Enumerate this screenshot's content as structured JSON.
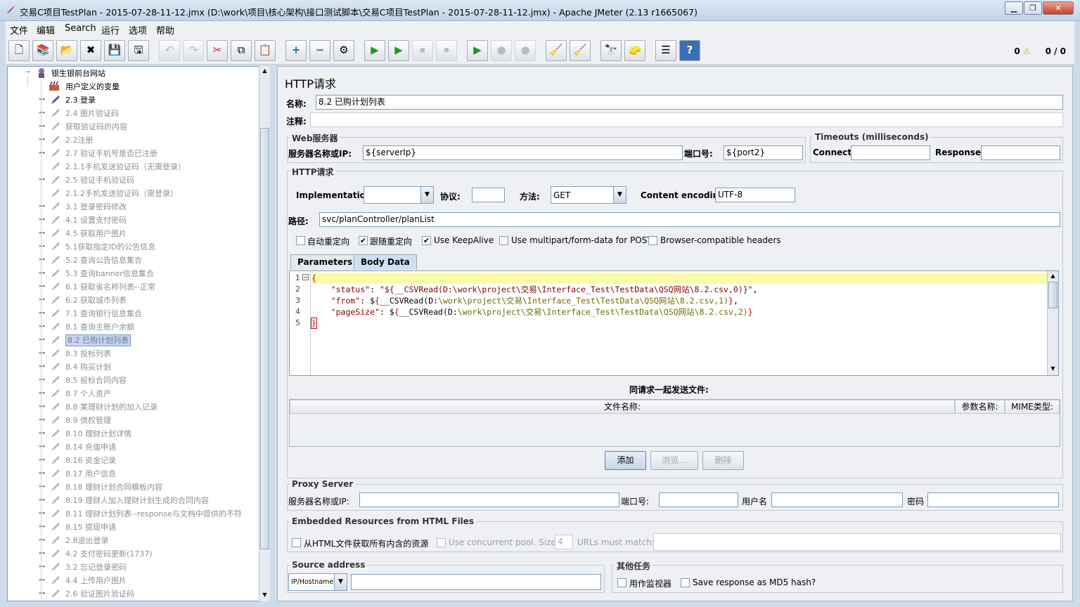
{
  "window": {
    "title": "交易C项目TestPlan - 2015-07-28-11-12.jmx (D:\\work\\项目\\核心架构\\接口测试脚本\\交易C项目TestPlan - 2015-07-28-11-12.jmx) - Apache JMeter (2.13 r1665067)",
    "min": "▁",
    "max": "❐",
    "close": "✕"
  },
  "menu": [
    "文件",
    "编辑",
    "Search",
    "运行",
    "选项",
    "帮助"
  ],
  "toolbar": {
    "icons": [
      {
        "name": "new-icon",
        "glyph": "🗋",
        "dis": false
      },
      {
        "name": "templates-icon",
        "glyph": "📚",
        "dis": false
      },
      {
        "name": "open-icon",
        "glyph": "📂",
        "dis": false
      },
      {
        "name": "close-file-icon",
        "glyph": "✖",
        "dis": false
      },
      {
        "name": "save-icon",
        "glyph": "💾",
        "dis": false
      },
      {
        "name": "save-as-icon",
        "glyph": "🖫",
        "dis": false
      },
      {
        "name": "undo-icon",
        "glyph": "↶",
        "dis": true
      },
      {
        "name": "redo-icon",
        "glyph": "↷",
        "dis": true
      },
      {
        "name": "cut-icon",
        "glyph": "✂",
        "dis": false
      },
      {
        "name": "copy-icon",
        "glyph": "⧉",
        "dis": false
      },
      {
        "name": "paste-icon",
        "glyph": "📋",
        "dis": false
      },
      {
        "name": "expand-icon",
        "glyph": "+",
        "dis": false
      },
      {
        "name": "collapse-icon",
        "glyph": "−",
        "dis": false
      },
      {
        "name": "toggle-icon",
        "glyph": "⚙",
        "dis": false
      },
      {
        "name": "start-icon",
        "glyph": "▶",
        "dis": false
      },
      {
        "name": "start-no-pause-icon",
        "glyph": "▶",
        "dis": false
      },
      {
        "name": "stop-icon",
        "glyph": "⏹",
        "dis": true
      },
      {
        "name": "shutdown-icon",
        "glyph": "⏺",
        "dis": true
      },
      {
        "name": "remote-start-icon",
        "glyph": "▶",
        "dis": false
      },
      {
        "name": "remote-stop-icon",
        "glyph": "●",
        "dis": true
      },
      {
        "name": "remote-shutdown-icon",
        "glyph": "●",
        "dis": true
      },
      {
        "name": "clear-icon",
        "glyph": "🧹",
        "dis": false
      },
      {
        "name": "clear-all-icon",
        "glyph": "🧹",
        "dis": false
      },
      {
        "name": "search-icon",
        "glyph": "🔭",
        "dis": false
      },
      {
        "name": "reset-search-icon",
        "glyph": "🧽",
        "dis": false
      },
      {
        "name": "function-helper-icon",
        "glyph": "☰",
        "dis": false
      },
      {
        "name": "help-icon",
        "glyph": "?",
        "dis": false
      }
    ],
    "error_count": "0",
    "warn_icon": "⚠",
    "threads": "0 / 0"
  },
  "tree": {
    "root": "银生银前台网站",
    "vars": "用户定义的变量",
    "items": [
      "2.3 登录",
      "2.4 图片验证码",
      "获取验证码的内容",
      "2.2注册",
      "2.7 验证手机号是否已注册",
      "2.1.1手机发送验证码（无需登录）",
      "2.5 验证手机验证码",
      "2.1.2手机发送验证码（需登录）",
      "3.1 登录密码修改",
      "4.1 设置支付密码",
      "4.5 获取用户图片",
      "5.1获取指定ID的公告信息",
      "5.2 查询公告信息集合",
      "5.3 查询banner信息集合",
      "6.1 获取省名称列表--正常",
      "6.2 获取城市列表",
      "7.1 查询银行信息集合",
      "8.1 查询主账户余额",
      "8.2 已购计划列表",
      "8.3 投标列表",
      "8.4 购买计划",
      "8.5 投标合同内容",
      "8.7 个人资产",
      "8.8 某理财计划的加入记录",
      "8.9 债权管理",
      "8.10 理财计划详情",
      "8.14 充值申请",
      "8.16 资金记录",
      "8.17 用户信息",
      "8.18 理财计划合同模板内容",
      "8.19 理财人加入理财计划生成的合同内容",
      "8.11 理财计划列表--response与文档中提供的不符",
      "8.15 提现申请",
      "2.8退出登录",
      "4.2 支付密码更新(1737)",
      "3.2 忘记登录密码",
      "4.4 上传用户图片",
      "2.6 验证图片验证码"
    ],
    "selected_index": 18,
    "active_index": 0
  },
  "main": {
    "heading": "HTTP请求",
    "name_label": "名称:",
    "name_value": "8.2 已购计划列表",
    "comment_label": "注释:",
    "comment_value": "",
    "web_server_legend": "Web服务器",
    "server_label": "服务器名称或IP:",
    "server_value": "${serverIp}",
    "port_label": "端口号:",
    "port_value": "${port2}",
    "timeouts_legend": "Timeouts (milliseconds)",
    "connect_label": "Connect:",
    "connect_value": "",
    "response_label": "Response:",
    "response_value": "",
    "http_legend": "HTTP请求",
    "impl_label": "Implementation:",
    "impl_value": "",
    "protocol_label": "协议:",
    "protocol_value": "",
    "method_label": "方法:",
    "method_value": "GET",
    "encoding_label": "Content encoding:",
    "encoding_value": "UTF-8",
    "path_label": "路径:",
    "path_value": "svc/planController/planList",
    "checkboxes": [
      {
        "label": "自动重定向",
        "checked": false
      },
      {
        "label": "跟随重定向",
        "checked": true
      },
      {
        "label": "Use KeepAlive",
        "checked": true
      },
      {
        "label": "Use multipart/form-data for POST",
        "checked": false
      },
      {
        "label": "Browser-compatible headers",
        "checked": false
      }
    ],
    "tabs": [
      "Parameters",
      "Body Data"
    ],
    "body_lines": [
      "1",
      "2",
      "3",
      "4",
      "5"
    ],
    "files_title": "同请求一起发送文件:",
    "files_cols": [
      "文件名称:",
      "参数名称:",
      "MIME类型:"
    ],
    "btn_add": "添加",
    "btn_browse": "浏览...",
    "btn_delete": "删除",
    "proxy_legend": "Proxy Server",
    "proxy_server_label": "服务器名称或IP:",
    "proxy_server_value": "",
    "proxy_port_label": "端口号:",
    "proxy_port_value": "",
    "proxy_user_label": "用户名",
    "proxy_user_value": "",
    "proxy_pass_label": "密码",
    "proxy_pass_value": "",
    "embedded_legend": "Embedded Resources from HTML Files",
    "embedded_chk": "从HTML文件获取所有内含的资源",
    "concurrent_chk": "Use concurrent pool. Size:",
    "pool_size": "4",
    "urls_label": "URLs must match:",
    "urls_value": "",
    "source_legend": "Source address",
    "source_type": "IP/Hostname",
    "source_value": "",
    "other_legend": "其他任务",
    "monitor_chk": "用作监视器",
    "md5_chk": "Save response as MD5 hash?"
  },
  "code": {
    "l1": "{",
    "l2a": "    \"status\"",
    "l2b": ": ",
    "l2c": "\"${__CSVRead(D:\\work\\project\\交易\\Interface_Test\\TestData\\QSQ网站\\8.2.csv,0)}\"",
    "l2d": ",",
    "l3a": "    \"from\"",
    "l3b": ": $",
    "l3c": "{",
    "l3d": "__CSVRead(D:",
    "l3e": "\\work\\project\\交易\\Interface_Test\\TestData\\QSQ网站\\8.2.csv,1)",
    "l3f": "}",
    "l3g": ",",
    "l4a": "    \"pageSize\"",
    "l4b": ": $",
    "l4c": "{",
    "l4d": "__CSVRead(D:",
    "l4e": "\\work\\project\\交易\\Interface_Test\\TestData\\QSQ网站\\8.2.csv,2)",
    "l4f": "}",
    "l5": "}"
  }
}
